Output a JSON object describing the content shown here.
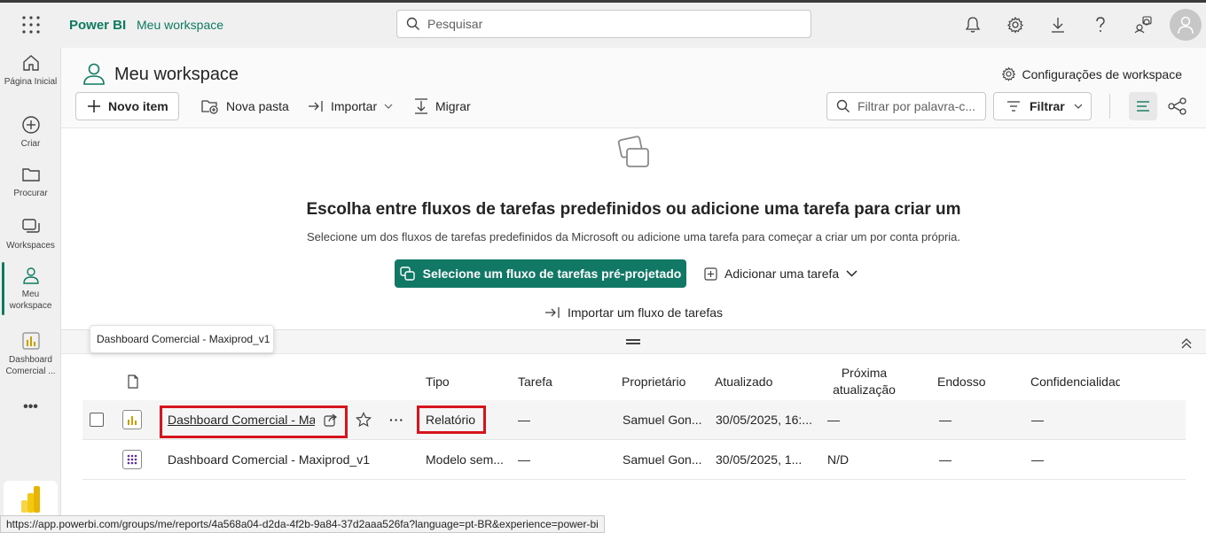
{
  "topbar": {
    "brand": "Power BI",
    "workspace_link": "Meu workspace",
    "search_placeholder": "Pesquisar",
    "icons": [
      "bell-icon",
      "gear-icon",
      "download-icon",
      "help-icon",
      "feedback-icon",
      "avatar"
    ]
  },
  "rail": {
    "items": [
      {
        "label": "Página Inicial",
        "icon": "home-icon"
      },
      {
        "label": "Criar",
        "icon": "create-icon"
      },
      {
        "label": "Procurar",
        "icon": "folder-icon"
      },
      {
        "label": "Workspaces",
        "icon": "workspaces-icon"
      },
      {
        "label": "Meu workspace",
        "icon": "person-icon"
      },
      {
        "label": "Dashboard Comercial ...",
        "icon": "report-icon"
      }
    ],
    "more": "•••"
  },
  "header": {
    "title": "Meu workspace",
    "config_label": "Configurações de workspace",
    "new_item": "Novo item",
    "new_folder": "Nova pasta",
    "import": "Importar",
    "migrate": "Migrar",
    "filter_placeholder": "Filtrar por palavra-c...",
    "filter_button": "Filtrar"
  },
  "flow": {
    "title": "Escolha entre fluxos de tarefas predefinidos ou adicione uma tarefa para criar um",
    "subtitle": "Selecione um dos fluxos de tarefas predefinidos da Microsoft ou adicione uma tarefa para começar a criar um por conta própria.",
    "primary_button": "Selecione um fluxo de tarefas pré-projetado",
    "add_task": "Adicionar uma tarefa",
    "import_flow": "Importar um fluxo de tarefas"
  },
  "table": {
    "columns": {
      "type": "Tipo",
      "task": "Tarefa",
      "owner": "Proprietário",
      "updated": "Atualizado",
      "next_refresh": "Próxima atualização",
      "endorsement": "Endosso",
      "sensitivity": "Confidencialidade"
    },
    "tooltip": "Dashboard Comercial - Maxiprod_v1",
    "rows": [
      {
        "name": "Dashboard Comercial - Maxiprod_v1",
        "type": "Relatório",
        "task": "—",
        "owner": "Samuel Gon...",
        "updated": "30/05/2025, 16:...",
        "next_refresh": "—",
        "endorsement": "—",
        "sensitivity": "—"
      },
      {
        "name": "Dashboard Comercial - Maxiprod_v1",
        "type": "Modelo sem...",
        "task": "—",
        "owner": "Samuel Gon...",
        "updated": "30/05/2025, 1...",
        "next_refresh": "N/D",
        "endorsement": "—",
        "sensitivity": "—"
      }
    ]
  },
  "status_url": "https://app.powerbi.com/groups/me/reports/4a568a04-d2da-4f2b-9a84-37d2aaa526fa?language=pt-BR&experience=power-bi",
  "colors": {
    "accent": "#117865",
    "highlight": "#d6141c"
  }
}
